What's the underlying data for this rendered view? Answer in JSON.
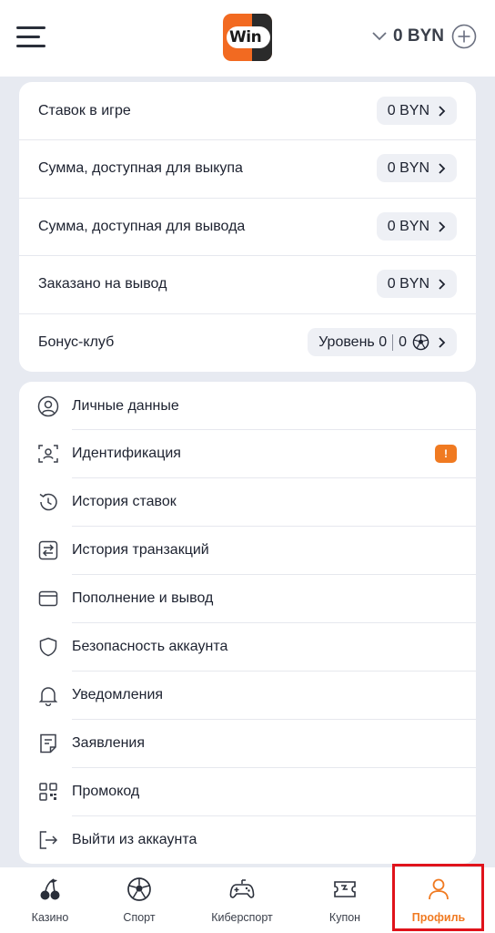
{
  "header": {
    "logo_text": "Win",
    "balance": "0 BYN"
  },
  "stats": [
    {
      "label": "Ставок в игре",
      "value": "0 BYN"
    },
    {
      "label": "Сумма, доступная для выкупа",
      "value": "0 BYN"
    },
    {
      "label": "Сумма, доступная для вывода",
      "value": "0 BYN"
    },
    {
      "label": "Заказано на вывод",
      "value": "0 BYN"
    }
  ],
  "bonus": {
    "label": "Бонус-клуб",
    "level": "Уровень 0",
    "points": "0"
  },
  "menu": [
    {
      "label": "Личные данные",
      "icon": "user-circle-icon"
    },
    {
      "label": "Идентификация",
      "icon": "id-scan-icon",
      "badge": "!"
    },
    {
      "label": "История ставок",
      "icon": "history-icon"
    },
    {
      "label": "История транзакций",
      "icon": "transfer-icon"
    },
    {
      "label": "Пополнение и вывод",
      "icon": "wallet-icon"
    },
    {
      "label": "Безопасность аккаунта",
      "icon": "shield-icon"
    },
    {
      "label": "Уведомления",
      "icon": "bell-icon"
    },
    {
      "label": "Заявления",
      "icon": "document-icon"
    },
    {
      "label": "Промокод",
      "icon": "qr-code-icon"
    },
    {
      "label": "Выйти из аккаунта",
      "icon": "logout-icon"
    }
  ],
  "nav": [
    {
      "label": "Казино",
      "icon": "cherry-icon"
    },
    {
      "label": "Спорт",
      "icon": "soccer-ball-icon"
    },
    {
      "label": "Киберспорт",
      "icon": "gamepad-icon"
    },
    {
      "label": "Купон",
      "icon": "ticket-icon"
    },
    {
      "label": "Профиль",
      "icon": "profile-icon",
      "active": true
    }
  ],
  "colors": {
    "accent": "#f07a21",
    "highlight": "#e0131b",
    "background": "#e7eaf1"
  }
}
